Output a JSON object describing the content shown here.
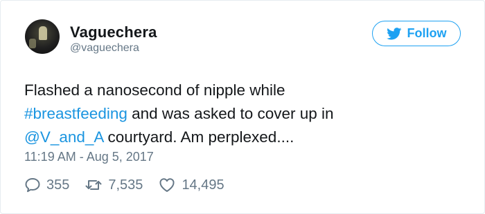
{
  "tweet": {
    "author": {
      "name": "Vaguechera",
      "handle": "@vaguechera"
    },
    "follow_label": "Follow",
    "text_parts": {
      "line1": "Flashed a nanosecond of nipple while",
      "hashtag": "#breastfeeding",
      "line2_rest": " and was asked to cover up in",
      "mention": "@V_and_A",
      "line3_rest": " courtyard. Am perplexed...."
    },
    "timestamp": "11:19 AM - Aug 5, 2017",
    "stats": {
      "replies": "355",
      "retweets": "7,535",
      "likes": "14,495"
    }
  },
  "colors": {
    "brand": "#1da1f2",
    "link": "#1b95e0",
    "muted": "#657786",
    "text": "#14171a"
  },
  "icons": [
    "twitter-bird-icon",
    "reply-icon",
    "retweet-icon",
    "heart-icon"
  ]
}
